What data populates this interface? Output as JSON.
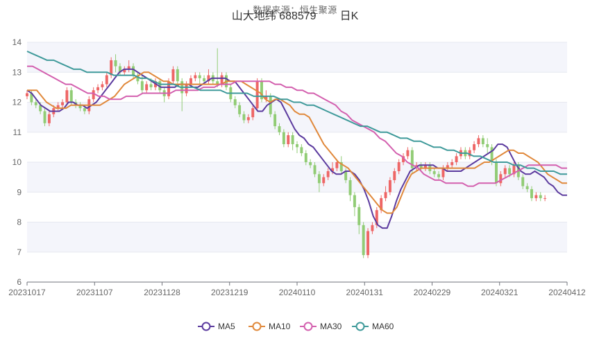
{
  "header": {
    "source": "数据来源：恒生聚源",
    "title": "山大地纬 688579",
    "period": "日K"
  },
  "colors": {
    "up": "#ee6666",
    "down": "#91cc75",
    "MA5": "#5b3a9e",
    "MA10": "#e0883a",
    "MA30": "#d35fae",
    "MA60": "#3f9a9a",
    "band": "#f4f5fb",
    "grid": "#e6e8f0"
  },
  "chart_data": {
    "type": "candlestick",
    "x_tick_labels": [
      "20231017",
      "20231107",
      "20231128",
      "20231219",
      "20240110",
      "20240131",
      "20240229",
      "20240321",
      "20240412"
    ],
    "y_ticks": [
      6,
      7,
      8,
      9,
      10,
      11,
      12,
      13,
      14
    ],
    "ylim": [
      6,
      14
    ],
    "n_days": 123,
    "legend": [
      "MA5",
      "MA10",
      "MA30",
      "MA60"
    ],
    "candles": [
      [
        12.2,
        12.3,
        12.1,
        12.4
      ],
      [
        12.3,
        12.0,
        11.9,
        12.4
      ],
      [
        12.0,
        11.9,
        11.8,
        12.1
      ],
      [
        11.9,
        11.7,
        11.6,
        12.0
      ],
      [
        11.7,
        11.3,
        11.2,
        11.8
      ],
      [
        11.3,
        11.6,
        11.2,
        11.7
      ],
      [
        11.6,
        11.8,
        11.5,
        11.9
      ],
      [
        11.8,
        11.9,
        11.7,
        12.0
      ],
      [
        11.9,
        12.0,
        11.8,
        12.1
      ],
      [
        12.0,
        12.4,
        11.9,
        12.5
      ],
      [
        12.4,
        12.0,
        11.9,
        12.5
      ],
      [
        12.0,
        11.9,
        11.8,
        12.1
      ],
      [
        11.9,
        11.8,
        11.7,
        12.0
      ],
      [
        11.8,
        11.7,
        11.6,
        11.9
      ],
      [
        11.7,
        12.1,
        11.6,
        12.2
      ],
      [
        12.1,
        12.4,
        12.0,
        12.5
      ],
      [
        12.4,
        12.5,
        12.3,
        12.6
      ],
      [
        12.5,
        12.6,
        12.4,
        12.7
      ],
      [
        12.6,
        12.9,
        12.5,
        13.0
      ],
      [
        12.9,
        13.4,
        12.8,
        13.5
      ],
      [
        13.4,
        13.2,
        13.0,
        13.6
      ],
      [
        13.2,
        13.0,
        12.9,
        13.3
      ],
      [
        13.0,
        13.1,
        12.9,
        13.2
      ],
      [
        13.1,
        13.2,
        13.0,
        13.4
      ],
      [
        13.2,
        12.9,
        12.8,
        13.3
      ],
      [
        12.9,
        12.7,
        12.6,
        13.0
      ],
      [
        12.7,
        12.4,
        12.3,
        12.9
      ],
      [
        12.4,
        12.6,
        12.3,
        12.7
      ],
      [
        12.6,
        12.5,
        12.4,
        12.8
      ],
      [
        12.5,
        12.7,
        12.4,
        12.8
      ],
      [
        12.7,
        12.4,
        12.3,
        12.8
      ],
      [
        12.4,
        12.2,
        12.0,
        12.5
      ],
      [
        12.2,
        12.7,
        12.1,
        12.8
      ],
      [
        12.7,
        13.1,
        12.6,
        13.2
      ],
      [
        13.1,
        12.7,
        12.5,
        13.2
      ],
      [
        12.7,
        12.3,
        11.7,
        12.8
      ],
      [
        12.3,
        12.6,
        12.2,
        12.7
      ],
      [
        12.6,
        12.8,
        12.5,
        12.9
      ],
      [
        12.8,
        12.9,
        12.7,
        13.0
      ],
      [
        12.9,
        12.8,
        12.6,
        13.0
      ],
      [
        12.8,
        12.7,
        12.6,
        12.9
      ],
      [
        12.7,
        12.9,
        12.6,
        13.1
      ],
      [
        12.9,
        12.7,
        12.6,
        13.0
      ],
      [
        12.7,
        12.6,
        12.5,
        13.8
      ],
      [
        12.6,
        12.9,
        12.5,
        13.0
      ],
      [
        12.9,
        12.5,
        12.4,
        13.0
      ],
      [
        12.5,
        12.1,
        12.0,
        12.6
      ],
      [
        12.1,
        11.9,
        11.8,
        12.2
      ],
      [
        11.9,
        11.6,
        11.5,
        12.0
      ],
      [
        11.6,
        11.4,
        11.3,
        11.7
      ],
      [
        11.4,
        11.5,
        11.3,
        11.6
      ],
      [
        11.5,
        11.8,
        11.4,
        11.9
      ],
      [
        11.8,
        12.7,
        11.7,
        12.8
      ],
      [
        12.7,
        12.1,
        12.0,
        12.8
      ],
      [
        12.1,
        12.2,
        12.0,
        12.4
      ],
      [
        12.2,
        11.6,
        11.5,
        12.3
      ],
      [
        11.6,
        11.2,
        11.1,
        11.7
      ],
      [
        11.2,
        11.0,
        10.9,
        11.3
      ],
      [
        11.0,
        10.6,
        10.5,
        11.1
      ],
      [
        10.6,
        10.9,
        10.5,
        11.0
      ],
      [
        10.9,
        10.6,
        10.4,
        11.0
      ],
      [
        10.6,
        10.5,
        10.3,
        10.7
      ],
      [
        10.5,
        10.3,
        10.2,
        10.6
      ],
      [
        10.3,
        10.0,
        9.9,
        10.4
      ],
      [
        10.0,
        9.9,
        9.8,
        10.1
      ],
      [
        9.9,
        9.6,
        9.5,
        10.0
      ],
      [
        9.6,
        9.3,
        9.0,
        9.7
      ],
      [
        9.3,
        9.5,
        9.2,
        9.6
      ],
      [
        9.5,
        9.7,
        9.4,
        9.8
      ],
      [
        9.7,
        9.8,
        9.6,
        10.0
      ],
      [
        9.8,
        10.0,
        9.7,
        10.1
      ],
      [
        10.0,
        9.7,
        9.6,
        10.2
      ],
      [
        9.7,
        9.4,
        9.3,
        9.8
      ],
      [
        9.4,
        8.9,
        8.7,
        9.5
      ],
      [
        8.9,
        8.5,
        8.2,
        9.0
      ],
      [
        8.5,
        7.9,
        7.6,
        8.6
      ],
      [
        7.9,
        6.9,
        6.8,
        8.0
      ],
      [
        6.9,
        7.7,
        6.8,
        7.8
      ],
      [
        7.7,
        7.9,
        7.6,
        8.0
      ],
      [
        7.9,
        8.4,
        7.8,
        8.5
      ],
      [
        8.4,
        8.8,
        8.3,
        8.9
      ],
      [
        8.8,
        9.0,
        8.7,
        9.2
      ],
      [
        9.0,
        9.4,
        8.9,
        9.5
      ],
      [
        9.4,
        9.7,
        9.3,
        9.8
      ],
      [
        9.7,
        10.0,
        9.6,
        10.1
      ],
      [
        10.0,
        10.2,
        9.9,
        10.3
      ],
      [
        10.2,
        10.4,
        10.1,
        10.5
      ],
      [
        10.4,
        9.8,
        9.6,
        10.5
      ],
      [
        9.8,
        9.9,
        9.7,
        10.0
      ],
      [
        9.9,
        9.8,
        9.7,
        10.0
      ],
      [
        9.8,
        9.9,
        9.7,
        10.0
      ],
      [
        9.9,
        9.7,
        9.6,
        10.0
      ],
      [
        9.7,
        9.6,
        9.5,
        9.8
      ],
      [
        9.6,
        9.5,
        9.4,
        9.7
      ],
      [
        9.5,
        9.8,
        9.4,
        9.9
      ],
      [
        9.8,
        9.9,
        9.7,
        10.0
      ],
      [
        9.9,
        10.0,
        9.8,
        10.1
      ],
      [
        10.0,
        10.2,
        9.9,
        10.3
      ],
      [
        10.2,
        10.4,
        10.1,
        10.5
      ],
      [
        10.4,
        10.2,
        10.1,
        10.5
      ],
      [
        10.2,
        10.4,
        10.1,
        10.5
      ],
      [
        10.4,
        10.6,
        10.3,
        10.7
      ],
      [
        10.6,
        10.8,
        10.5,
        10.9
      ],
      [
        10.8,
        10.6,
        10.5,
        10.9
      ],
      [
        10.6,
        10.5,
        10.3,
        10.8
      ],
      [
        10.5,
        10.0,
        9.9,
        10.6
      ],
      [
        10.0,
        9.3,
        9.2,
        10.1
      ],
      [
        9.3,
        9.6,
        9.2,
        9.7
      ],
      [
        9.6,
        9.8,
        9.5,
        9.9
      ],
      [
        9.8,
        9.6,
        9.5,
        9.9
      ],
      [
        9.6,
        9.9,
        9.5,
        10.0
      ],
      [
        9.9,
        9.5,
        9.4,
        10.0
      ],
      [
        9.5,
        9.2,
        9.1,
        9.6
      ],
      [
        9.2,
        9.1,
        9.0,
        9.3
      ],
      [
        9.1,
        8.8,
        8.7,
        9.2
      ],
      [
        8.8,
        8.9,
        8.7,
        9.0
      ],
      [
        8.9,
        8.8,
        8.7,
        9.0
      ],
      [
        8.8,
        8.8,
        8.7,
        8.9
      ]
    ],
    "series": [
      {
        "name": "MA5",
        "values": [
          12.4,
          12.3,
          12.1,
          11.9,
          11.8,
          11.7,
          11.7,
          11.7,
          11.8,
          12.0,
          12.0,
          11.9,
          11.9,
          11.8,
          11.9,
          12.0,
          12.2,
          12.4,
          12.6,
          12.8,
          13.0,
          13.1,
          13.1,
          13.1,
          13.0,
          12.9,
          12.8,
          12.7,
          12.6,
          12.5,
          12.5,
          12.5,
          12.5,
          12.6,
          12.6,
          12.6,
          12.5,
          12.5,
          12.6,
          12.7,
          12.8,
          12.8,
          12.8,
          12.8,
          12.7,
          12.7,
          12.5,
          12.3,
          12.1,
          11.9,
          11.7,
          11.7,
          11.9,
          12.0,
          12.1,
          12.0,
          11.7,
          11.4,
          11.1,
          10.9,
          10.8,
          10.6,
          10.5,
          10.3,
          10.1,
          9.9,
          9.7,
          9.6,
          9.6,
          9.7,
          9.7,
          9.6,
          9.4,
          9.1,
          8.7,
          8.2,
          7.9,
          7.8,
          7.8,
          8.2,
          8.7,
          9.1,
          9.4,
          9.7,
          9.8,
          9.9,
          9.9,
          9.9,
          9.9,
          9.8,
          9.8,
          9.7,
          9.7,
          9.7,
          9.7,
          9.8,
          9.9,
          10.0,
          10.1,
          10.2,
          10.3,
          10.4,
          10.6,
          10.6,
          10.5,
          10.2,
          9.9,
          9.7,
          9.6,
          9.6,
          9.7,
          9.6,
          9.5,
          9.3,
          9.2,
          9.0,
          8.9,
          8.9
        ]
      },
      {
        "name": "MA10",
        "values": [
          12.4,
          12.4,
          12.4,
          12.2,
          12.0,
          11.9,
          11.8,
          11.8,
          11.8,
          11.9,
          11.9,
          11.9,
          11.9,
          11.9,
          11.9,
          11.9,
          12.0,
          12.1,
          12.2,
          12.4,
          12.6,
          12.7,
          12.8,
          12.9,
          13.0,
          13.0,
          12.9,
          12.8,
          12.7,
          12.7,
          12.6,
          12.6,
          12.6,
          12.6,
          12.6,
          12.6,
          12.6,
          12.6,
          12.6,
          12.6,
          12.6,
          12.7,
          12.7,
          12.7,
          12.7,
          12.6,
          12.5,
          12.4,
          12.3,
          12.1,
          12.0,
          12.1,
          12.1,
          12.0,
          11.9,
          11.7,
          11.6,
          11.6,
          11.5,
          11.2,
          10.9,
          10.6,
          10.4,
          10.2,
          10.0,
          9.9,
          9.8,
          9.6,
          9.4,
          9.2,
          9.0,
          8.8,
          8.6,
          8.4,
          8.3,
          8.3,
          8.5,
          8.9,
          9.3,
          9.6,
          9.7,
          9.8,
          9.8,
          9.8,
          9.8,
          9.8,
          9.8,
          9.8,
          9.8,
          9.8,
          9.8,
          9.8,
          9.8,
          9.9,
          10.0,
          10.0,
          10.1,
          10.2,
          10.3,
          10.4,
          10.4,
          10.3,
          10.3,
          10.2,
          10.1,
          10.0,
          9.8,
          9.6,
          9.5,
          9.4,
          9.3,
          9.3
        ]
      },
      {
        "name": "MA30",
        "values": [
          13.2,
          13.2,
          13.1,
          13.0,
          12.9,
          12.8,
          12.7,
          12.6,
          12.6,
          12.5,
          12.4,
          12.3,
          12.3,
          12.2,
          12.2,
          12.1,
          12.1,
          12.1,
          12.2,
          12.2,
          12.2,
          12.3,
          12.3,
          12.3,
          12.3,
          12.3,
          12.3,
          12.4,
          12.4,
          12.4,
          12.4,
          12.4,
          12.5,
          12.5,
          12.5,
          12.6,
          12.6,
          12.6,
          12.7,
          12.7,
          12.7,
          12.7,
          12.7,
          12.7,
          12.7,
          12.6,
          12.6,
          12.5,
          12.5,
          12.4,
          12.4,
          12.3,
          12.3,
          12.2,
          12.1,
          12.0,
          11.9,
          11.7,
          11.6,
          11.4,
          11.3,
          11.2,
          11.1,
          11.0,
          10.8,
          10.7,
          10.5,
          10.3,
          10.2,
          10.0,
          9.9,
          9.8,
          9.6,
          9.5,
          9.4,
          9.4,
          9.3,
          9.3,
          9.3,
          9.3,
          9.2,
          9.2,
          9.3,
          9.3,
          9.3,
          9.3,
          9.4,
          9.5,
          9.6,
          9.7,
          9.8,
          9.9,
          9.9,
          9.9,
          9.9,
          9.9,
          9.9,
          9.8,
          9.8
        ]
      },
      {
        "name": "MA60",
        "values": [
          13.7,
          13.6,
          13.5,
          13.4,
          13.4,
          13.3,
          13.2,
          13.1,
          13.1,
          13.0,
          13.0,
          13.0,
          13.0,
          12.9,
          12.9,
          12.9,
          12.9,
          12.8,
          12.8,
          12.7,
          12.6,
          12.6,
          12.6,
          12.5,
          12.5,
          12.5,
          12.4,
          12.4,
          12.4,
          12.4,
          12.3,
          12.3,
          12.3,
          12.3,
          12.2,
          12.2,
          12.2,
          12.2,
          12.1,
          12.1,
          12.0,
          12.0,
          11.9,
          11.9,
          11.8,
          11.7,
          11.6,
          11.5,
          11.4,
          11.3,
          11.2,
          11.2,
          11.1,
          11.0,
          11.0,
          10.9,
          10.8,
          10.8,
          10.7,
          10.7,
          10.6,
          10.5,
          10.5,
          10.4,
          10.4,
          10.3,
          10.3,
          10.2,
          10.2,
          10.1,
          10.0,
          10.0,
          10.0,
          9.9,
          9.9,
          9.8,
          9.8,
          9.7,
          9.7,
          9.7,
          9.6,
          9.6
        ]
      }
    ]
  }
}
